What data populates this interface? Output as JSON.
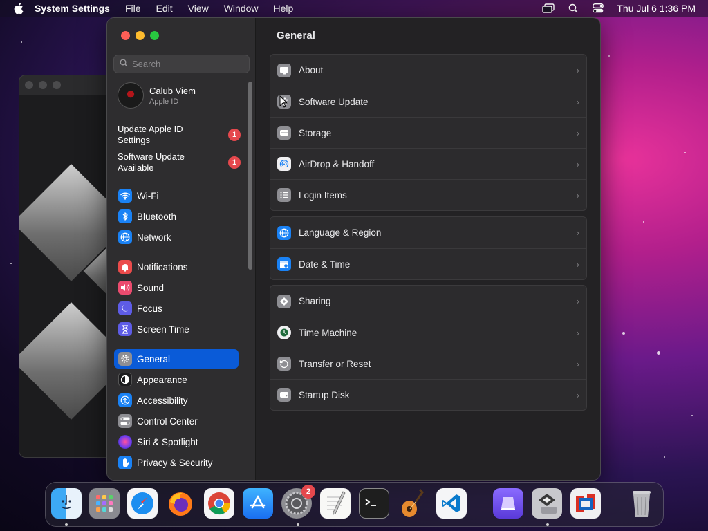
{
  "menubar": {
    "app_name": "System Settings",
    "menus": [
      "File",
      "Edit",
      "View",
      "Window",
      "Help"
    ],
    "clock": "Thu Jul 6  1:36 PM"
  },
  "sidebar": {
    "search_placeholder": "Search",
    "profile": {
      "name": "Calub Viem",
      "subtitle": "Apple ID"
    },
    "notices": [
      {
        "label": "Update Apple ID Settings",
        "badge": "1"
      },
      {
        "label": "Software Update Available",
        "badge": "1"
      }
    ],
    "items": [
      {
        "label": "Wi-Fi",
        "icon": "wifi-icon",
        "color": "#1a82f5"
      },
      {
        "label": "Bluetooth",
        "icon": "bluetooth-icon",
        "color": "#1a82f5"
      },
      {
        "label": "Network",
        "icon": "globe-icon",
        "color": "#1a82f5"
      },
      {
        "label": "Notifications",
        "icon": "bell-icon",
        "color": "#eb4b4b"
      },
      {
        "label": "Sound",
        "icon": "speaker-icon",
        "color": "#eb4b6e"
      },
      {
        "label": "Focus",
        "icon": "moon-icon",
        "color": "#5e5ce6"
      },
      {
        "label": "Screen Time",
        "icon": "hourglass-icon",
        "color": "#5e5ce6"
      },
      {
        "label": "General",
        "icon": "gear-icon",
        "color": "#8e8e93"
      },
      {
        "label": "Appearance",
        "icon": "appearance-icon",
        "color": "#1c1c1e"
      },
      {
        "label": "Accessibility",
        "icon": "accessibility-icon",
        "color": "#1a82f5"
      },
      {
        "label": "Control Center",
        "icon": "toggle-icon",
        "color": "#8e8e93"
      },
      {
        "label": "Siri & Spotlight",
        "icon": "siri-icon",
        "color": "#a34bd9"
      },
      {
        "label": "Privacy & Security",
        "icon": "hand-icon",
        "color": "#1a82f5"
      }
    ],
    "selected": "General"
  },
  "main": {
    "title": "General",
    "groups": [
      [
        {
          "label": "About",
          "icon": "computer-icon"
        },
        {
          "label": "Software Update",
          "icon": "gear-update-icon"
        },
        {
          "label": "Storage",
          "icon": "disk-icon"
        },
        {
          "label": "AirDrop & Handoff",
          "icon": "airdrop-icon"
        },
        {
          "label": "Login Items",
          "icon": "list-icon"
        }
      ],
      [
        {
          "label": "Language & Region",
          "icon": "globe-icon"
        },
        {
          "label": "Date & Time",
          "icon": "calendar-icon"
        }
      ],
      [
        {
          "label": "Sharing",
          "icon": "sharing-icon"
        },
        {
          "label": "Time Machine",
          "icon": "time-machine-icon"
        },
        {
          "label": "Transfer or Reset",
          "icon": "reset-icon"
        },
        {
          "label": "Startup Disk",
          "icon": "startup-disk-icon"
        }
      ]
    ]
  },
  "dock": {
    "apps": [
      "Finder",
      "Launchpad",
      "Safari",
      "Firefox",
      "Chrome",
      "App Store",
      "System Settings",
      "TextEdit",
      "Terminal",
      "GarageBand",
      "VS Code",
      "Apple Configurator",
      "Boot Camp",
      "Parallels",
      "Trash"
    ],
    "settings_badge": "2"
  }
}
